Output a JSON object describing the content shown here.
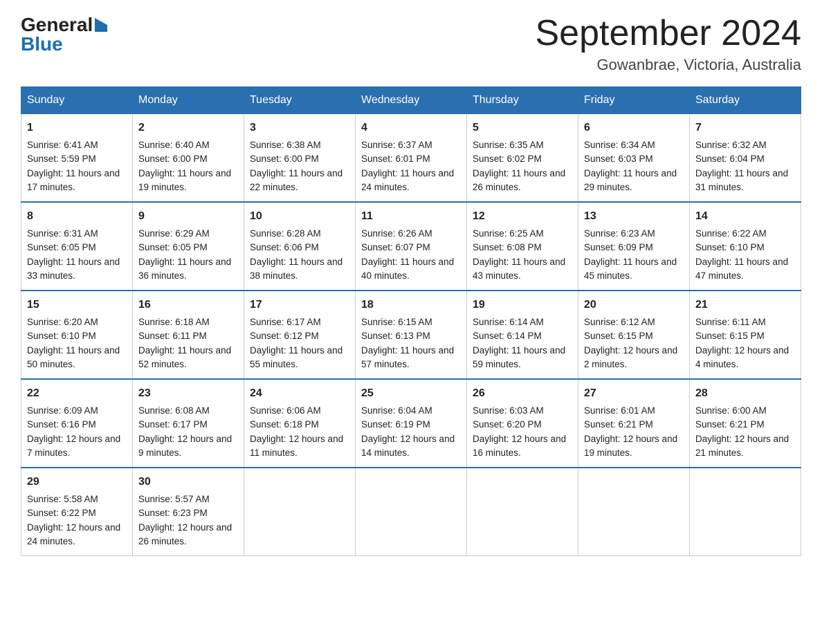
{
  "logo": {
    "general": "General",
    "blue": "Blue"
  },
  "title": "September 2024",
  "subtitle": "Gowanbrae, Victoria, Australia",
  "days": [
    "Sunday",
    "Monday",
    "Tuesday",
    "Wednesday",
    "Thursday",
    "Friday",
    "Saturday"
  ],
  "weeks": [
    [
      {
        "num": "1",
        "sunrise": "6:41 AM",
        "sunset": "5:59 PM",
        "daylight": "11 hours and 17 minutes."
      },
      {
        "num": "2",
        "sunrise": "6:40 AM",
        "sunset": "6:00 PM",
        "daylight": "11 hours and 19 minutes."
      },
      {
        "num": "3",
        "sunrise": "6:38 AM",
        "sunset": "6:00 PM",
        "daylight": "11 hours and 22 minutes."
      },
      {
        "num": "4",
        "sunrise": "6:37 AM",
        "sunset": "6:01 PM",
        "daylight": "11 hours and 24 minutes."
      },
      {
        "num": "5",
        "sunrise": "6:35 AM",
        "sunset": "6:02 PM",
        "daylight": "11 hours and 26 minutes."
      },
      {
        "num": "6",
        "sunrise": "6:34 AM",
        "sunset": "6:03 PM",
        "daylight": "11 hours and 29 minutes."
      },
      {
        "num": "7",
        "sunrise": "6:32 AM",
        "sunset": "6:04 PM",
        "daylight": "11 hours and 31 minutes."
      }
    ],
    [
      {
        "num": "8",
        "sunrise": "6:31 AM",
        "sunset": "6:05 PM",
        "daylight": "11 hours and 33 minutes."
      },
      {
        "num": "9",
        "sunrise": "6:29 AM",
        "sunset": "6:05 PM",
        "daylight": "11 hours and 36 minutes."
      },
      {
        "num": "10",
        "sunrise": "6:28 AM",
        "sunset": "6:06 PM",
        "daylight": "11 hours and 38 minutes."
      },
      {
        "num": "11",
        "sunrise": "6:26 AM",
        "sunset": "6:07 PM",
        "daylight": "11 hours and 40 minutes."
      },
      {
        "num": "12",
        "sunrise": "6:25 AM",
        "sunset": "6:08 PM",
        "daylight": "11 hours and 43 minutes."
      },
      {
        "num": "13",
        "sunrise": "6:23 AM",
        "sunset": "6:09 PM",
        "daylight": "11 hours and 45 minutes."
      },
      {
        "num": "14",
        "sunrise": "6:22 AM",
        "sunset": "6:10 PM",
        "daylight": "11 hours and 47 minutes."
      }
    ],
    [
      {
        "num": "15",
        "sunrise": "6:20 AM",
        "sunset": "6:10 PM",
        "daylight": "11 hours and 50 minutes."
      },
      {
        "num": "16",
        "sunrise": "6:18 AM",
        "sunset": "6:11 PM",
        "daylight": "11 hours and 52 minutes."
      },
      {
        "num": "17",
        "sunrise": "6:17 AM",
        "sunset": "6:12 PM",
        "daylight": "11 hours and 55 minutes."
      },
      {
        "num": "18",
        "sunrise": "6:15 AM",
        "sunset": "6:13 PM",
        "daylight": "11 hours and 57 minutes."
      },
      {
        "num": "19",
        "sunrise": "6:14 AM",
        "sunset": "6:14 PM",
        "daylight": "11 hours and 59 minutes."
      },
      {
        "num": "20",
        "sunrise": "6:12 AM",
        "sunset": "6:15 PM",
        "daylight": "12 hours and 2 minutes."
      },
      {
        "num": "21",
        "sunrise": "6:11 AM",
        "sunset": "6:15 PM",
        "daylight": "12 hours and 4 minutes."
      }
    ],
    [
      {
        "num": "22",
        "sunrise": "6:09 AM",
        "sunset": "6:16 PM",
        "daylight": "12 hours and 7 minutes."
      },
      {
        "num": "23",
        "sunrise": "6:08 AM",
        "sunset": "6:17 PM",
        "daylight": "12 hours and 9 minutes."
      },
      {
        "num": "24",
        "sunrise": "6:06 AM",
        "sunset": "6:18 PM",
        "daylight": "12 hours and 11 minutes."
      },
      {
        "num": "25",
        "sunrise": "6:04 AM",
        "sunset": "6:19 PM",
        "daylight": "12 hours and 14 minutes."
      },
      {
        "num": "26",
        "sunrise": "6:03 AM",
        "sunset": "6:20 PM",
        "daylight": "12 hours and 16 minutes."
      },
      {
        "num": "27",
        "sunrise": "6:01 AM",
        "sunset": "6:21 PM",
        "daylight": "12 hours and 19 minutes."
      },
      {
        "num": "28",
        "sunrise": "6:00 AM",
        "sunset": "6:21 PM",
        "daylight": "12 hours and 21 minutes."
      }
    ],
    [
      {
        "num": "29",
        "sunrise": "5:58 AM",
        "sunset": "6:22 PM",
        "daylight": "12 hours and 24 minutes."
      },
      {
        "num": "30",
        "sunrise": "5:57 AM",
        "sunset": "6:23 PM",
        "daylight": "12 hours and 26 minutes."
      },
      null,
      null,
      null,
      null,
      null
    ]
  ],
  "labels": {
    "sunrise": "Sunrise:",
    "sunset": "Sunset:",
    "daylight": "Daylight:"
  }
}
